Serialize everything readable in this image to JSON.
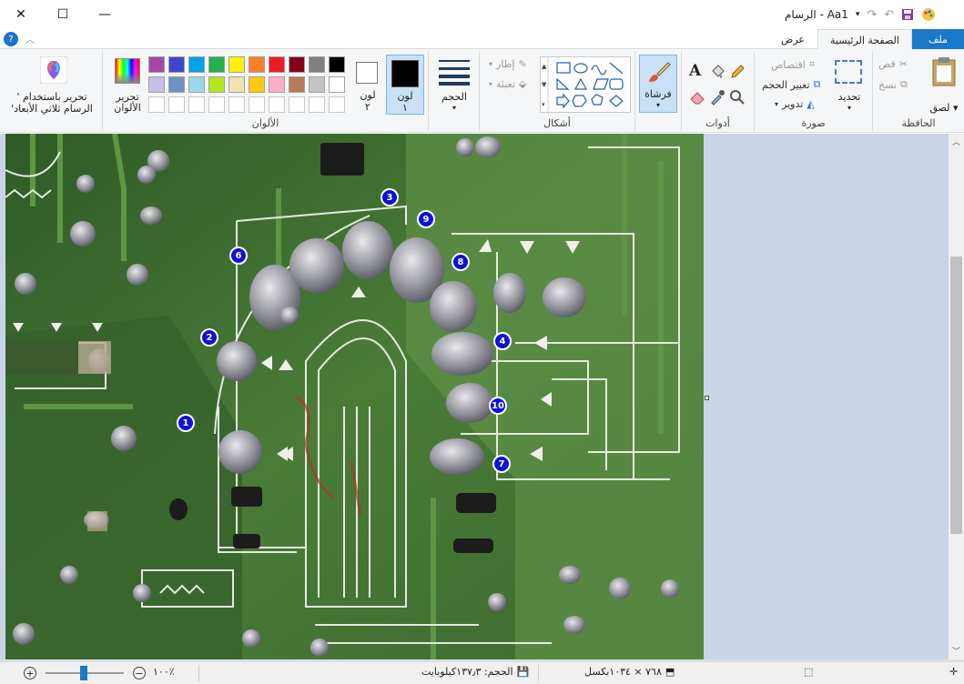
{
  "window": {
    "title": "Aa1 - الرسام",
    "minimize_glyph": "—",
    "maximize_glyph": "☐",
    "close_glyph": "✕"
  },
  "tabs": {
    "file": "ملف",
    "home": "الصفحة الرئيسية",
    "view": "عرض"
  },
  "clipboard": {
    "paste": "لصق",
    "cut": "قص",
    "copy": "نسخ",
    "group_label": "الحافظة"
  },
  "image": {
    "select": "تحديد",
    "crop": "اقتصاص",
    "resize": "تغيير الحجم",
    "rotate": "تدوير",
    "group_label": "صورة"
  },
  "tools": {
    "group_label": "أدوات"
  },
  "brushes": {
    "label": "فرشاة"
  },
  "shapes": {
    "outline": "إطار",
    "fill": "تعبئة",
    "group_label": "أشكال"
  },
  "size": {
    "label": "الحجم"
  },
  "colors": {
    "color1_label": "لون",
    "color1_num": "١",
    "color2_label": "لون",
    "color2_num": "٢",
    "edit_colors_line1": "تحرير",
    "edit_colors_line2": "الألوان",
    "group_label": "الألوان",
    "color1": "#000000",
    "color2": "#ffffff",
    "palette_row1": [
      "#000000",
      "#7f7f7f",
      "#880015",
      "#ed1c24",
      "#ff7f27",
      "#fff200",
      "#22b14c",
      "#00a2e8",
      "#3f48cc",
      "#a349a4"
    ],
    "palette_row2": [
      "#ffffff",
      "#c3c3c3",
      "#b97a57",
      "#ffaec9",
      "#ffc90e",
      "#efe4b0",
      "#b5e61d",
      "#99d9ea",
      "#7092be",
      "#c8bfe7"
    ],
    "palette_row3": [
      "#ffffff",
      "#ffffff",
      "#ffffff",
      "#ffffff",
      "#ffffff",
      "#ffffff",
      "#ffffff",
      "#ffffff",
      "#ffffff",
      "#ffffff"
    ]
  },
  "paint3d": {
    "line1": "تحرير باستخدام '",
    "line2": "الرسام ثلاثي الأبعاد'"
  },
  "markers": [
    "1",
    "2",
    "3",
    "4",
    "6",
    "7",
    "8",
    "9",
    "10"
  ],
  "status": {
    "dimensions": "٧٦٨ × ١٠٣٤بكسل",
    "filesize": "الحجم: ١٣٧٫٣كيلوبايت",
    "zoom": "١٠٠٪"
  }
}
